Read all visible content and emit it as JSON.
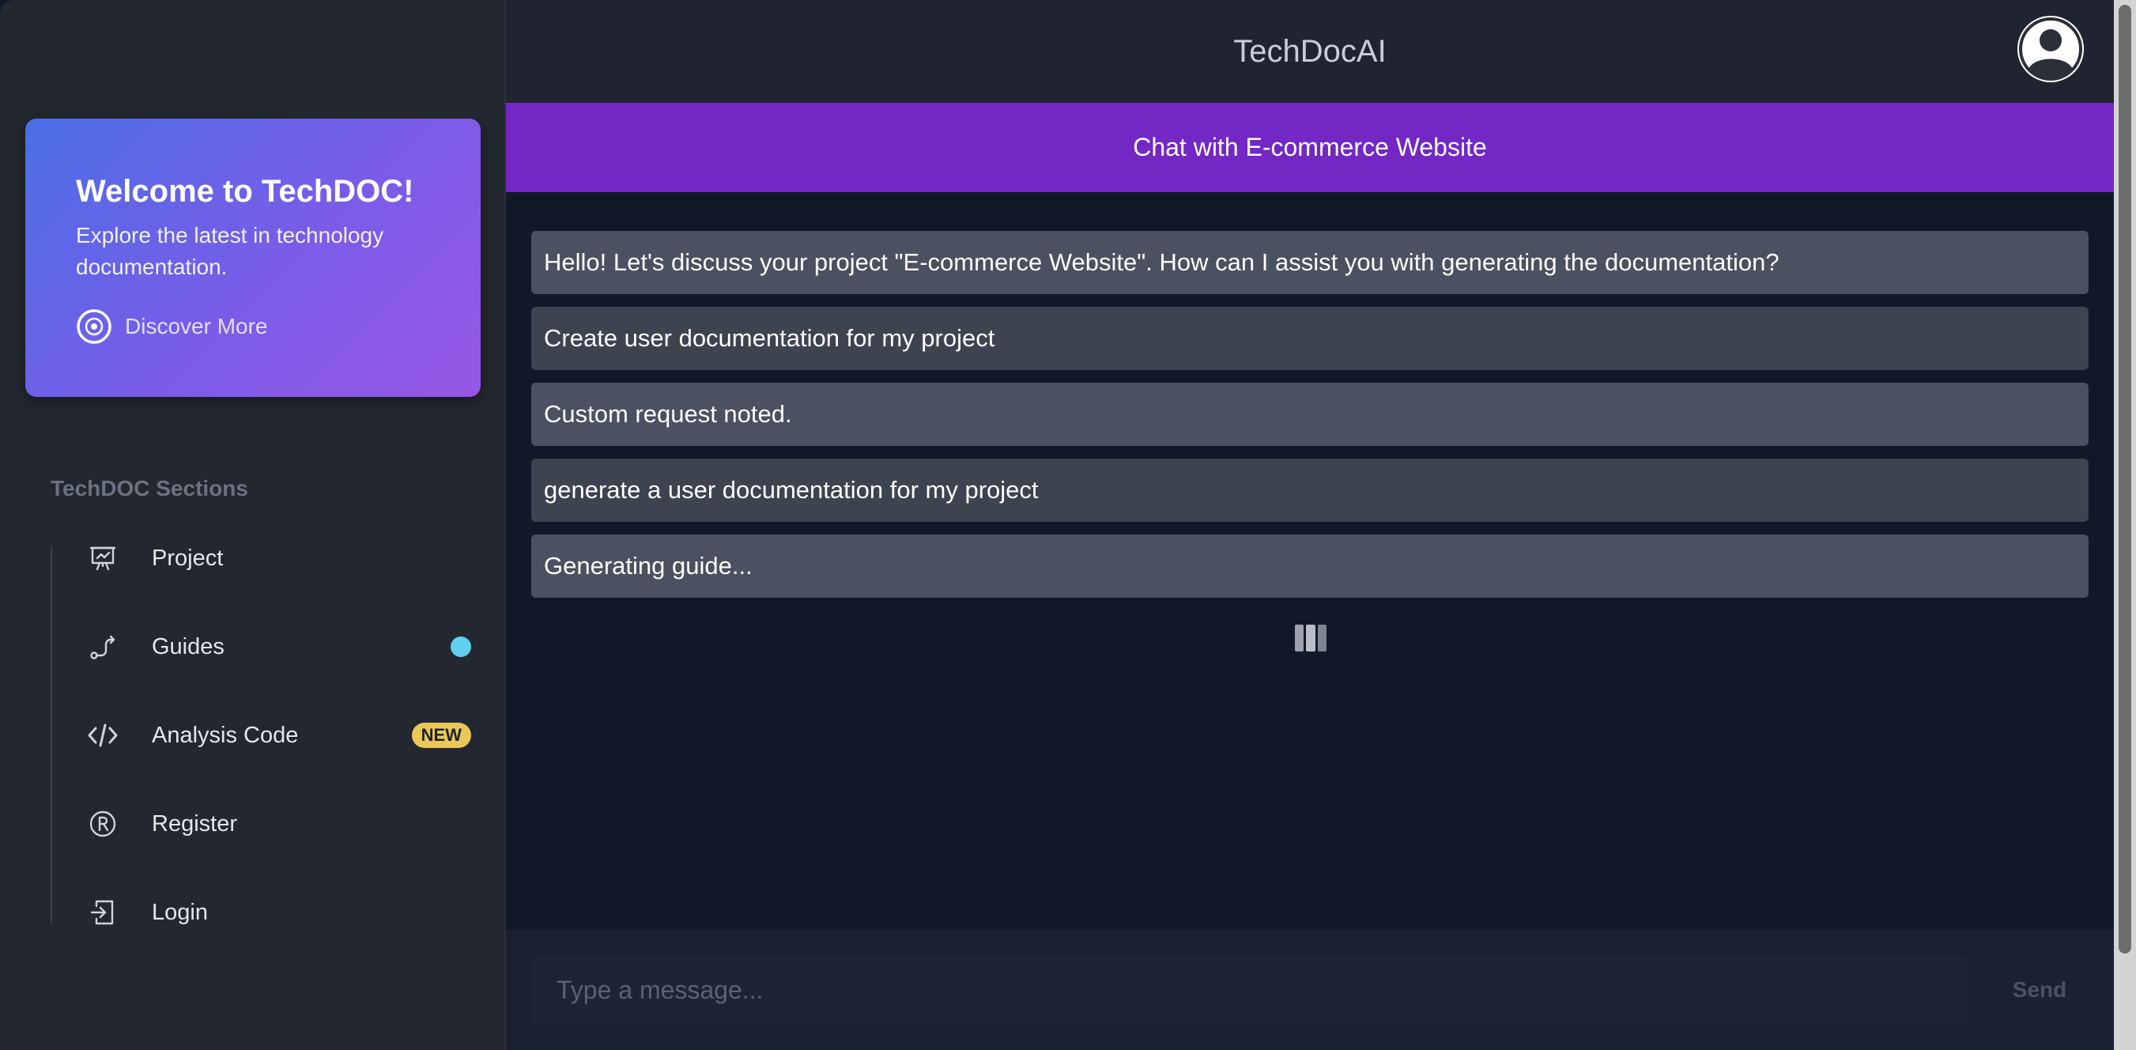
{
  "sidebar": {
    "welcome": {
      "title": "Welcome to TechDOC!",
      "text": "Explore the latest in technology documentation.",
      "discover_label": "Discover More"
    },
    "section_title": "TechDOC Sections",
    "items": [
      {
        "label": "Project",
        "icon": "presentation-chart-icon"
      },
      {
        "label": "Guides",
        "icon": "route-icon",
        "indicator": "dot",
        "indicator_color": "#5fd0ee"
      },
      {
        "label": "Analysis Code",
        "icon": "code-icon",
        "badge": "NEW"
      },
      {
        "label": "Register",
        "icon": "registered-icon"
      },
      {
        "label": "Login",
        "icon": "login-icon"
      }
    ]
  },
  "header": {
    "app_title": "TechDocAI",
    "avatar_icon": "user-avatar-icon"
  },
  "chat": {
    "title": "Chat with E-commerce Website",
    "messages": [
      "Hello! Let's discuss your project \"E-commerce Website\". How can I assist you with generating the documentation?",
      "Create user documentation for my project",
      "Custom request noted.",
      "generate a user documentation for my project",
      "Generating guide..."
    ],
    "loading_icon": "loading-bars-icon"
  },
  "composer": {
    "placeholder": "Type a message...",
    "value": "",
    "send_label": "Send"
  },
  "colors": {
    "accent": "#7327c5",
    "card_gradient_start": "#4b6ee6",
    "card_gradient_end": "#9757e6",
    "badge": "#e9c857"
  }
}
